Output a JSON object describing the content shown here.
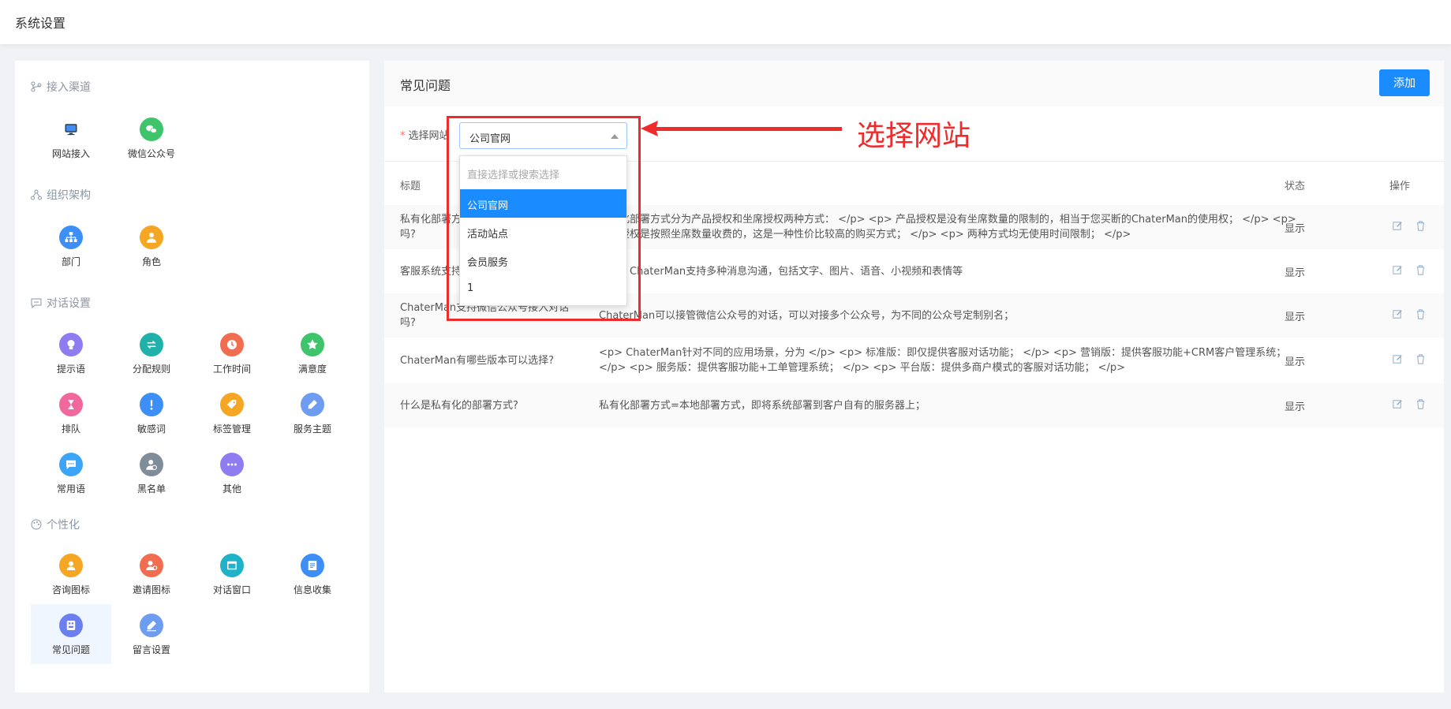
{
  "header": {
    "title": "系统设置"
  },
  "sidebar": {
    "sections": [
      {
        "title": "接入渠道",
        "icon": "branch-icon",
        "items": [
          {
            "label": "网站接入",
            "icon": "monitor-icon",
            "color": "#2c3e50"
          },
          {
            "label": "微信公众号",
            "icon": "wechat-icon",
            "color": "#3fc46b"
          }
        ]
      },
      {
        "title": "组织架构",
        "icon": "org-icon",
        "items": [
          {
            "label": "部门",
            "icon": "sitemap-icon",
            "color": "#3d8ff7"
          },
          {
            "label": "角色",
            "icon": "user-icon",
            "color": "#f5a623"
          }
        ]
      },
      {
        "title": "对话设置",
        "icon": "chat-icon",
        "items": [
          {
            "label": "提示语",
            "icon": "bulb-icon",
            "color": "#8e7cf0"
          },
          {
            "label": "分配规则",
            "icon": "switch-icon",
            "color": "#20b2aa"
          },
          {
            "label": "工作时间",
            "icon": "clock-icon",
            "color": "#f26c4f"
          },
          {
            "label": "满意度",
            "icon": "star-icon",
            "color": "#3fc46b"
          },
          {
            "label": "排队",
            "icon": "hourglass-icon",
            "color": "#f0689c"
          },
          {
            "label": "敏感词",
            "icon": "exclamation-icon",
            "color": "#3d8ff7"
          },
          {
            "label": "标签管理",
            "icon": "tag-icon",
            "color": "#f5a623"
          },
          {
            "label": "服务主题",
            "icon": "pen-icon",
            "color": "#6e9cf0"
          },
          {
            "label": "常用语",
            "icon": "message-icon",
            "color": "#3da5f7"
          },
          {
            "label": "黑名单",
            "icon": "block-user-icon",
            "color": "#7f8c9a"
          },
          {
            "label": "其他",
            "icon": "more-icon",
            "color": "#8e7cf0"
          }
        ]
      },
      {
        "title": "个性化",
        "icon": "palette-icon",
        "items": [
          {
            "label": "咨询图标",
            "icon": "consult-icon",
            "color": "#f5a623"
          },
          {
            "label": "邀请图标",
            "icon": "invite-icon",
            "color": "#f26c4f"
          },
          {
            "label": "对话窗口",
            "icon": "window-icon",
            "color": "#20b2c8"
          },
          {
            "label": "信息收集",
            "icon": "form-icon",
            "color": "#3d8ff7"
          },
          {
            "label": "常见问题",
            "icon": "faq-icon",
            "color": "#6c7ff0",
            "active": true
          },
          {
            "label": "留言设置",
            "icon": "edit-icon",
            "color": "#6e9cf0"
          }
        ]
      }
    ]
  },
  "main": {
    "title": "常见问题",
    "add_label": "添加",
    "filter": {
      "required_mark": "*",
      "label": "选择网站",
      "selected": "公司官网",
      "search_placeholder": "直接选择或搜索选择",
      "options": [
        "公司官网",
        "活动站点",
        "会员服务",
        "1"
      ]
    },
    "table": {
      "headers": {
        "title": "标题",
        "status": "状态",
        "ops": "操作"
      },
      "rows": [
        {
          "title": "私有化部署方式是否有坐席数量的限制吗?",
          "content": "私有化部署方式分为产品授权和坐席授权两种方式： </p> <p> 产品授权是没有坐席数量的限制的，相当于您买断的ChaterMan的使用权； </p> <p> 坐席授权是按照坐席数量收费的，这是一种性价比较高的购买方式； </p> <p> 两种方式均无使用时间限制； </p>",
          "status": "显示"
        },
        {
          "title": "客服系统支持哪些消息沟通?",
          "content": "目前，ChaterMan支持多种消息沟通，包括文字、图片、语音、小视频和表情等",
          "status": "显示"
        },
        {
          "title": "ChaterMan支持微信公众号接入对话吗?",
          "content": "ChaterMan可以接管微信公众号的对话，可以对接多个公众号，为不同的公众号定制别名；",
          "status": "显示"
        },
        {
          "title": "ChaterMan有哪些版本可以选择?",
          "content": "<p> ChaterMan针对不同的应用场景，分为 </p> <p> 标准版：即仅提供客服对话功能； </p> <p> 营销版：提供客服功能+CRM客户管理系统； </p> <p> 服务版：提供客服功能+工单管理系统； </p> <p> 平台版：提供多商户模式的客服对话功能； </p>",
          "status": "显示"
        },
        {
          "title": "什么是私有化的部署方式?",
          "content": "私有化部署方式=本地部署方式，即将系统部署到客户自有的服务器上；",
          "status": "显示"
        }
      ]
    }
  },
  "annotation": {
    "text": "选择网站",
    "color": "#ef2b2b"
  }
}
